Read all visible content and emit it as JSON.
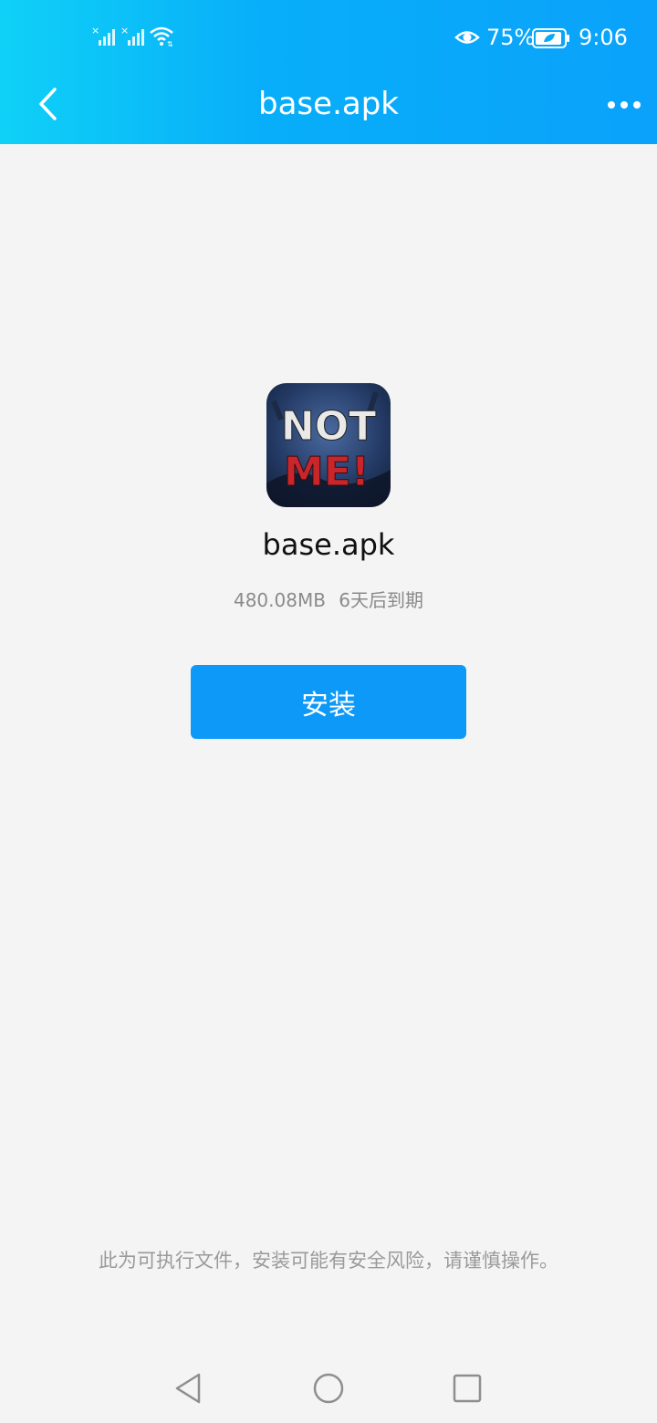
{
  "status_bar": {
    "battery_percent": "75%",
    "time": "9:06"
  },
  "header": {
    "title": "base.apk",
    "back_icon": "chevron-left-icon",
    "more_icon": "more-horizontal-icon",
    "gradient_colors": [
      "#0fd1f7",
      "#0aa2fb"
    ]
  },
  "file": {
    "icon_text_top": "NOT",
    "icon_text_bottom": "ME!",
    "name": "base.apk",
    "size": "480.08MB",
    "expiry": "6天后到期"
  },
  "install_button": {
    "label": "安装",
    "color": "#0c99f8"
  },
  "warning_text": "此为可执行文件，安装可能有安全风险，请谨慎操作。",
  "nav_bar": {
    "back_icon": "triangle-back-icon",
    "home_icon": "circle-home-icon",
    "recent_icon": "square-recents-icon"
  }
}
